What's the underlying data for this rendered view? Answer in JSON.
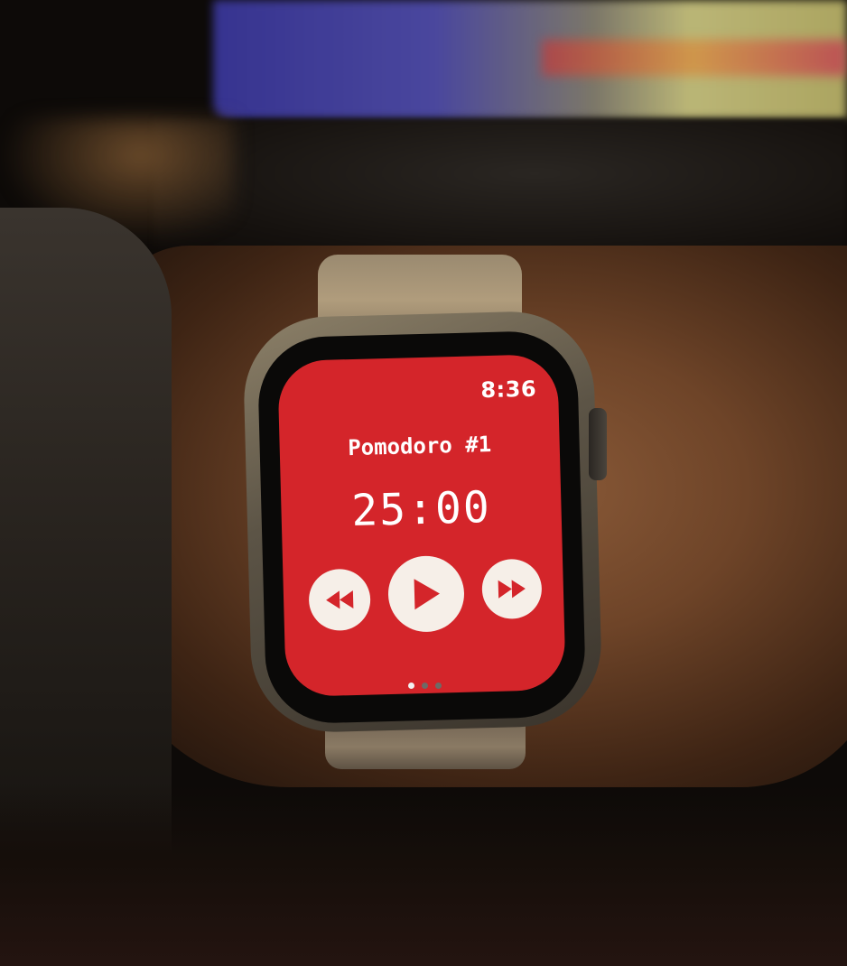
{
  "watch": {
    "status_time": "8:36",
    "session_title": "Pomodoro #1",
    "timer": "25:00",
    "screen_color": "#d4252a",
    "controls": {
      "rewind_icon": "rewind-icon",
      "play_icon": "play-icon",
      "fast_forward_icon": "fast-forward-icon"
    },
    "page_indicator": {
      "count": 3,
      "active_index": 0
    }
  }
}
